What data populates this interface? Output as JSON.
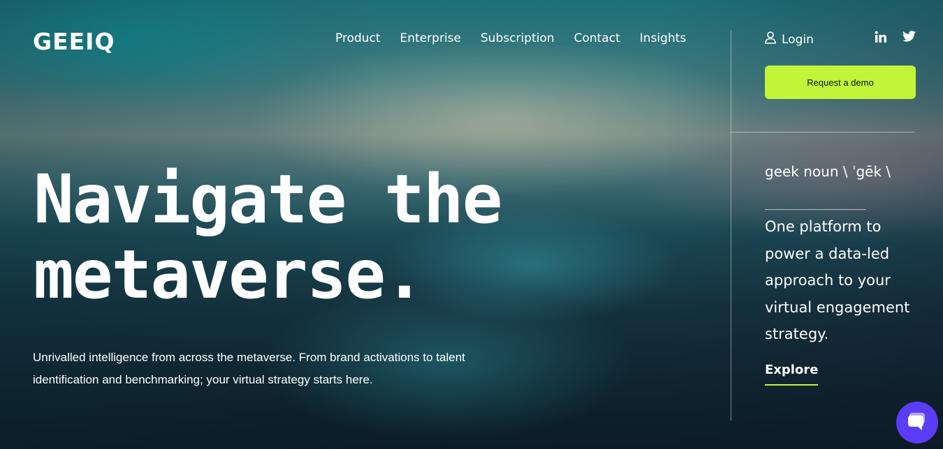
{
  "brand": {
    "logo": "GEEIQ"
  },
  "nav": {
    "items": [
      "Product",
      "Enterprise",
      "Subscription",
      "Contact",
      "Insights"
    ]
  },
  "account": {
    "login_label": "Login",
    "login_icon": "user-icon"
  },
  "socials": [
    {
      "icon": "linkedin-icon",
      "label": "in"
    },
    {
      "icon": "twitter-icon"
    }
  ],
  "cta": {
    "demo_label": "Request a demo"
  },
  "hero": {
    "title_line1": "Navigate the",
    "title_line2": "metaverse.",
    "subtitle": "Unrivalled intelligence from across the metaverse. From brand activations to talent identification and benchmarking; your virtual strategy starts here."
  },
  "side": {
    "definition": "geek noun \\ ˈgēk \\",
    "dashes": "_______________",
    "copy": "One platform to power a data-led approach to your virtual engagement strategy.",
    "explore_label": "Explore"
  },
  "colors": {
    "accent": "#c2f53a",
    "chat": "#5b3df5"
  }
}
